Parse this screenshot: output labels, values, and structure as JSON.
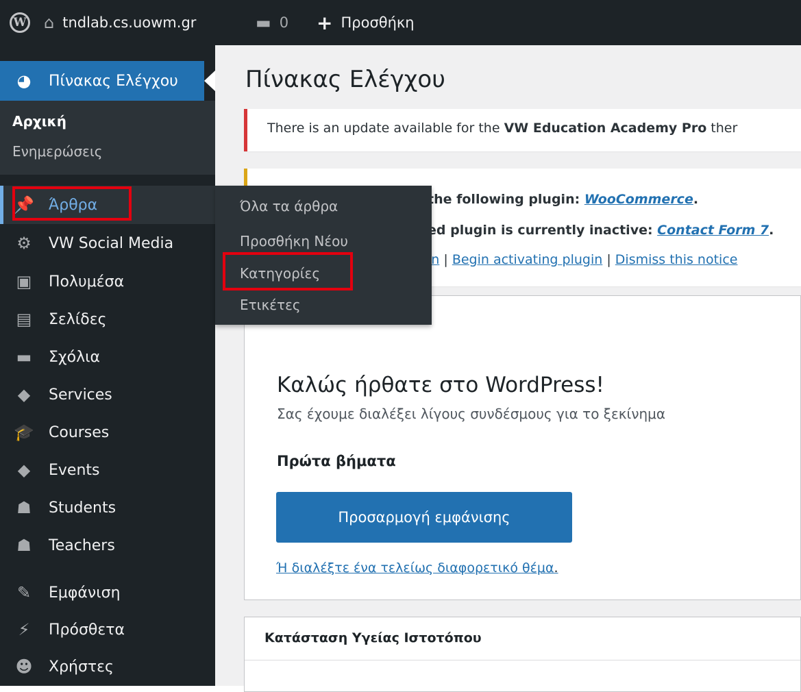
{
  "adminbar": {
    "site_name": "tndlab.cs.uowm.gr",
    "comments_count": "0",
    "new_label": "Προσθήκη"
  },
  "sidebar": {
    "dashboard": "Πίνακας Ελέγχου",
    "dashboard_sub": [
      "Αρχική",
      "Ενημερώσεις"
    ],
    "items": [
      {
        "label": "Άρθρα",
        "icon": "pin-icon"
      },
      {
        "label": "VW Social Media",
        "icon": "gear-icon"
      },
      {
        "label": "Πολυμέσα",
        "icon": "media-icon"
      },
      {
        "label": "Σελίδες",
        "icon": "page-icon"
      },
      {
        "label": "Σχόλια",
        "icon": "comment-icon"
      },
      {
        "label": "Services",
        "icon": "tag-icon"
      },
      {
        "label": "Courses",
        "icon": "graduation-cap-icon"
      },
      {
        "label": "Events",
        "icon": "tag-icon"
      },
      {
        "label": "Students",
        "icon": "users-icon"
      },
      {
        "label": "Teachers",
        "icon": "users-icon"
      },
      {
        "label": "Εμφάνιση",
        "icon": "brush-icon"
      },
      {
        "label": "Πρόσθετα",
        "icon": "plugin-icon"
      },
      {
        "label": "Χρήστες",
        "icon": "user-icon"
      }
    ]
  },
  "flyout": {
    "items": [
      "Όλα τα άρθρα",
      "Προσθήκη Νέου",
      "Κατηγορίες",
      "Ετικέτες"
    ]
  },
  "main": {
    "title": "Πίνακας Ελέγχου",
    "update_notice_prefix": "There is an update available for the ",
    "update_notice_theme": "VW Education Academy Pro",
    "update_notice_suffix": " ther",
    "plugin_line1_prefix": "the following plugin: ",
    "plugin_line1_link": "WooCommerce",
    "plugin_line2_prefix": "ed plugin is currently inactive: ",
    "plugin_line2_link": "Contact Form 7",
    "plugin_line3_a": "in",
    "plugin_line3_b": "Begin activating plugin",
    "plugin_line3_c": "Dismiss this notice",
    "welcome_title": "Καλώς ήρθατε στο WordPress!",
    "welcome_sub": "Σας έχουμε διαλέξει λίγους συνδέσμους για το ξεκίνημα",
    "first_steps": "Πρώτα βήματα",
    "customize_button": "Προσαρμογή εμφάνισης",
    "choose_theme_link": "Ή διαλέξτε ένα τελείως διαφορετικό θέμα",
    "health_title": "Κατάσταση Υγείας Ιστοτόπου"
  },
  "colors": {
    "adminbar_bg": "#1d2327",
    "accent": "#2271b1",
    "highlight_box": "#e3000f",
    "notice_error": "#d63638",
    "notice_warning": "#dba617"
  }
}
